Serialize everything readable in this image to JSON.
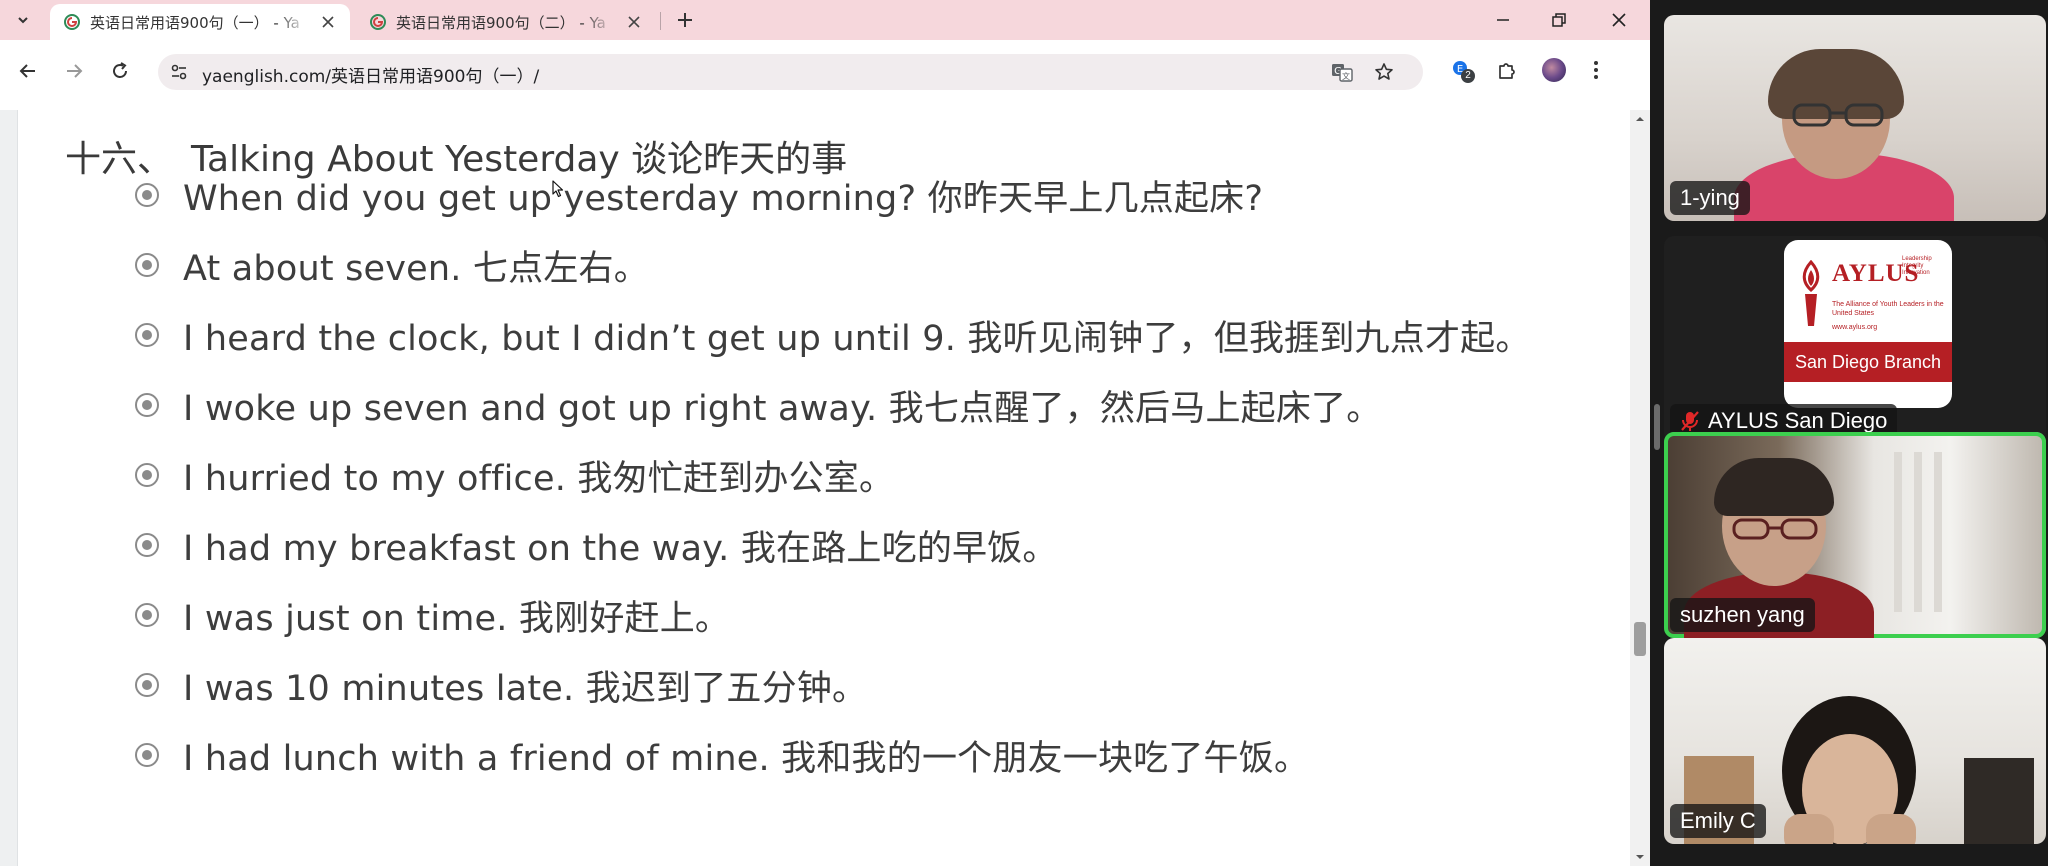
{
  "browser": {
    "tabs": [
      {
        "title": "英语日常用语900句（一） - Ya",
        "active": true
      },
      {
        "title": "英语日常用语900句（二） - Ya",
        "active": false
      }
    ],
    "address": {
      "url": "yaenglish.com/英语日常用语900句（一）/"
    },
    "extension_badge": "2"
  },
  "page": {
    "heading": {
      "number": "十六、",
      "title": "Talking About Yesterday 谈论昨天的事"
    },
    "sentences": [
      "When did you get up yesterday morning? 你昨天早上几点起床?",
      "At about seven. 七点左右。",
      "I heard the clock, but I didn’t get up until 9. 我听见闹钟了，但我捱到九点才起。",
      "I woke up seven and got up right away. 我七点醒了，然后马上起床了。",
      "I hurried to my office. 我匆忙赶到办公室。",
      "I had my breakfast on the way. 我在路上吃的早饭。",
      "I was just on time. 我刚好赶上。",
      "I was 10 minutes late. 我迟到了五分钟。",
      "I had lunch with a friend of mine. 我和我的一个朋友一块吃了午饭。"
    ]
  },
  "meeting": {
    "participants": [
      {
        "name": "1-ying",
        "muted": false,
        "speaking": false
      },
      {
        "name": "AYLUS San Diego",
        "muted": true,
        "speaking": false
      },
      {
        "name": "suzhen  yang",
        "muted": false,
        "speaking": true
      },
      {
        "name": "Emily C",
        "muted": false,
        "speaking": false
      }
    ],
    "aylus_logo": {
      "brand": "AYLUS",
      "tagline": "The Alliance of Youth Leaders in the United States",
      "motto": "Leadership Integrity Innovation",
      "site": "www.aylus.org",
      "branch": "San Diego Branch"
    }
  }
}
